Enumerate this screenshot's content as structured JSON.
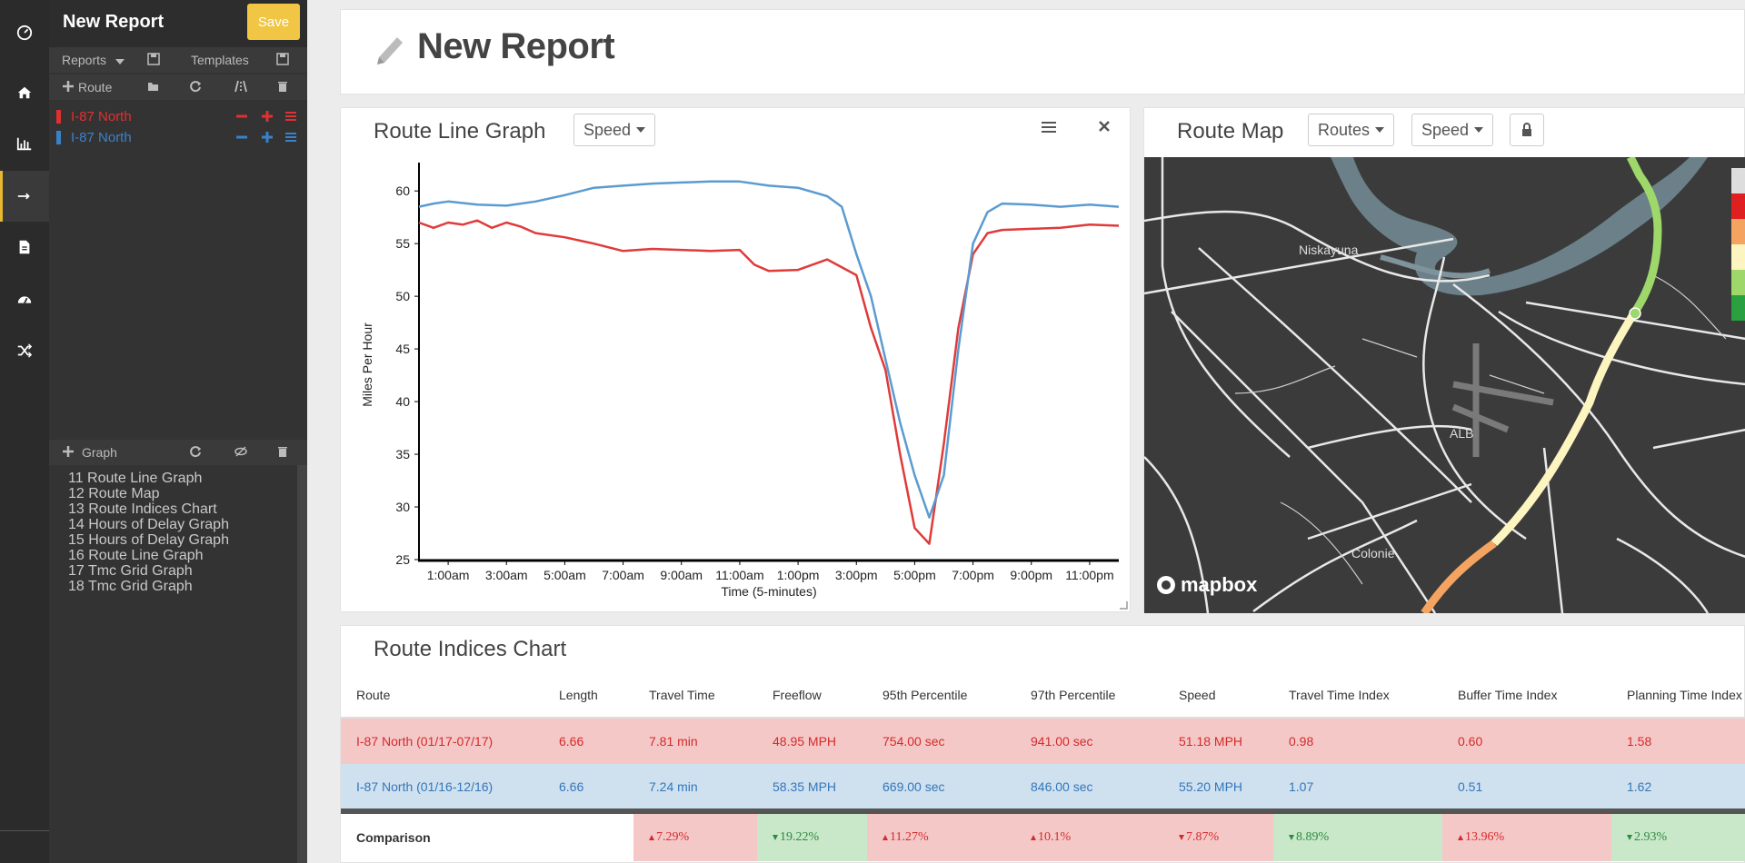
{
  "sidebar": {
    "title": "New Report",
    "save_label": "Save",
    "reports_label": "Reports",
    "templates_label": "Templates",
    "route_label": "Route",
    "graph_label": "Graph",
    "routes": [
      {
        "name": "I-87 North",
        "color": "#e03030"
      },
      {
        "name": "I-87 North",
        "color": "#3a82c8"
      }
    ],
    "graphs": [
      "11 Route Line Graph",
      "12 Route Map",
      "13 Route Indices Chart",
      "14 Hours of Delay Graph",
      "15 Hours of Delay Graph",
      "16 Route Line Graph",
      "17 Tmc Grid Graph",
      "18 Tmc Grid Graph"
    ]
  },
  "header": {
    "title": "New Report"
  },
  "line_graph": {
    "title": "Route Line Graph",
    "dropdown": "Speed"
  },
  "map": {
    "title": "Route Map",
    "dropdown_routes": "Routes",
    "dropdown_speed": "Speed",
    "labels": [
      "Niskayuna",
      "ALB",
      "Colonie"
    ],
    "attribution": "mapbox",
    "legend_colors": [
      "#dddddd",
      "#e02020",
      "#f4a460",
      "#fdf5c0",
      "#9fd86a",
      "#2aa040"
    ]
  },
  "indices": {
    "title": "Route Indices Chart",
    "columns": [
      "Route",
      "Length",
      "Travel Time",
      "Freeflow",
      "95th Percentile",
      "97th Percentile",
      "Speed",
      "Travel Time Index",
      "Buffer Time Index",
      "Planning Time Index"
    ],
    "rows": [
      [
        "I-87 North (01/17-07/17)",
        "6.66",
        "7.81 min",
        "48.95 MPH",
        "754.00 sec",
        "941.00 sec",
        "51.18 MPH",
        "0.98",
        "0.60",
        "1.58"
      ],
      [
        "I-87 North (01/16-12/16)",
        "6.66",
        "7.24 min",
        "58.35 MPH",
        "669.00 sec",
        "846.00 sec",
        "55.20 MPH",
        "1.07",
        "0.51",
        "1.62"
      ]
    ],
    "comparison_label": "Comparison",
    "comparison": [
      {
        "value": "7.29%",
        "dir": "up",
        "status": "red"
      },
      {
        "value": "19.22%",
        "dir": "down",
        "status": "green"
      },
      {
        "value": "11.27%",
        "dir": "up",
        "status": "red"
      },
      {
        "value": "10.1%",
        "dir": "up",
        "status": "red"
      },
      {
        "value": "7.87%",
        "dir": "down",
        "status": "red"
      },
      {
        "value": "8.89%",
        "dir": "down",
        "status": "green"
      },
      {
        "value": "13.96%",
        "dir": "up",
        "status": "red"
      },
      {
        "value": "2.93%",
        "dir": "down",
        "status": "green"
      }
    ]
  },
  "chart_data": {
    "type": "line",
    "title": "",
    "xlabel": "Time (5-minutes)",
    "ylabel": "Miles Per Hour",
    "ylim": [
      25,
      62
    ],
    "yticks": [
      25,
      30,
      35,
      40,
      45,
      50,
      55,
      60
    ],
    "xlim": [
      0,
      24
    ],
    "xtick_values": [
      1,
      3,
      5,
      7,
      9,
      11,
      13,
      15,
      17,
      19,
      21,
      23
    ],
    "xtick_labels": [
      "1:00am",
      "3:00am",
      "5:00am",
      "7:00am",
      "9:00am",
      "11:00am",
      "1:00pm",
      "3:00pm",
      "5:00pm",
      "7:00pm",
      "9:00pm",
      "11:00pm"
    ],
    "grid": false,
    "series": [
      {
        "color": "#e03a3a",
        "points": [
          [
            0,
            57
          ],
          [
            0.5,
            56.5
          ],
          [
            1,
            57
          ],
          [
            1.5,
            56.8
          ],
          [
            2,
            57.2
          ],
          [
            2.5,
            56.5
          ],
          [
            3,
            57
          ],
          [
            3.5,
            56.6
          ],
          [
            4,
            56
          ],
          [
            5,
            55.6
          ],
          [
            6,
            55
          ],
          [
            7,
            54.3
          ],
          [
            8,
            54.5
          ],
          [
            9,
            54.4
          ],
          [
            10,
            54.3
          ],
          [
            11,
            54.4
          ],
          [
            11.5,
            53
          ],
          [
            12,
            52.4
          ],
          [
            13,
            52.5
          ],
          [
            14,
            53.5
          ],
          [
            15,
            52
          ],
          [
            15.5,
            47
          ],
          [
            16,
            43
          ],
          [
            16.5,
            35
          ],
          [
            17,
            28
          ],
          [
            17.5,
            26.5
          ],
          [
            18,
            36
          ],
          [
            18.5,
            47
          ],
          [
            19,
            54
          ],
          [
            19.5,
            56
          ],
          [
            20,
            56.3
          ],
          [
            21,
            56.4
          ],
          [
            22,
            56.5
          ],
          [
            23,
            56.8
          ],
          [
            24,
            56.7
          ]
        ]
      },
      {
        "color": "#5b9bd0",
        "points": [
          [
            0,
            58.5
          ],
          [
            0.5,
            58.8
          ],
          [
            1,
            59
          ],
          [
            2,
            58.7
          ],
          [
            3,
            58.6
          ],
          [
            4,
            59
          ],
          [
            5,
            59.6
          ],
          [
            6,
            60.3
          ],
          [
            7,
            60.5
          ],
          [
            8,
            60.7
          ],
          [
            9,
            60.8
          ],
          [
            10,
            60.9
          ],
          [
            11,
            60.9
          ],
          [
            12,
            60.5
          ],
          [
            13,
            60.3
          ],
          [
            14,
            59.5
          ],
          [
            14.5,
            58.5
          ],
          [
            15,
            54
          ],
          [
            15.5,
            50
          ],
          [
            16,
            44
          ],
          [
            16.5,
            38
          ],
          [
            17,
            33
          ],
          [
            17.5,
            29
          ],
          [
            18,
            33
          ],
          [
            18.5,
            45
          ],
          [
            19,
            55
          ],
          [
            19.5,
            58
          ],
          [
            20,
            58.8
          ],
          [
            21,
            58.7
          ],
          [
            22,
            58.5
          ],
          [
            23,
            58.7
          ],
          [
            24,
            58.5
          ]
        ]
      }
    ]
  }
}
